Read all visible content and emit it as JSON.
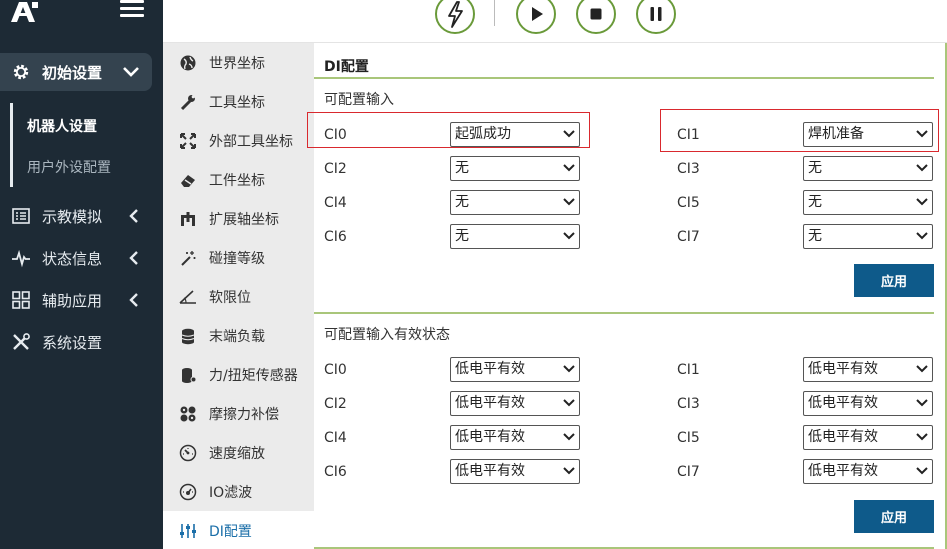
{
  "sidebar": {
    "section": "初始设置",
    "sub_items": [
      "机器人设置",
      "用户外设配置"
    ],
    "nav": [
      "示教模拟",
      "状态信息",
      "辅助应用",
      "系统设置"
    ]
  },
  "toolbar": {
    "buttons": [
      "lightning-icon",
      "play-icon",
      "stop-icon",
      "pause-icon"
    ],
    "accent": "#6a9a3a"
  },
  "submenu": {
    "items": [
      "世界坐标",
      "工具坐标",
      "外部工具坐标",
      "工件坐标",
      "扩展轴坐标",
      "碰撞等级",
      "软限位",
      "末端负载",
      "力/扭矩传感器",
      "摩擦力补偿",
      "速度缩放",
      "IO滤波",
      "DI配置"
    ],
    "active_index": 12
  },
  "main": {
    "title": "DI配置",
    "section1": {
      "heading": "可配置输入",
      "rows": [
        [
          {
            "label": "CI0",
            "value": "起弧成功"
          },
          {
            "label": "CI1",
            "value": "焊机准备"
          }
        ],
        [
          {
            "label": "CI2",
            "value": "无"
          },
          {
            "label": "CI3",
            "value": "无"
          }
        ],
        [
          {
            "label": "CI4",
            "value": "无"
          },
          {
            "label": "CI5",
            "value": "无"
          }
        ],
        [
          {
            "label": "CI6",
            "value": "无"
          },
          {
            "label": "CI7",
            "value": "无"
          }
        ]
      ],
      "apply": "应用"
    },
    "section2": {
      "heading": "可配置输入有效状态",
      "rows": [
        [
          {
            "label": "CI0",
            "value": "低电平有效"
          },
          {
            "label": "CI1",
            "value": "低电平有效"
          }
        ],
        [
          {
            "label": "CI2",
            "value": "低电平有效"
          },
          {
            "label": "CI3",
            "value": "低电平有效"
          }
        ],
        [
          {
            "label": "CI4",
            "value": "低电平有效"
          },
          {
            "label": "CI5",
            "value": "低电平有效"
          }
        ],
        [
          {
            "label": "CI6",
            "value": "低电平有效"
          },
          {
            "label": "CI7",
            "value": "低电平有效"
          }
        ]
      ],
      "apply": "应用"
    }
  },
  "colors": {
    "sidebar_bg": "#1d2a35",
    "apply_button": "#0e5a8a",
    "highlight_box": "#d9292e",
    "divider_green": "#a9c67a"
  }
}
